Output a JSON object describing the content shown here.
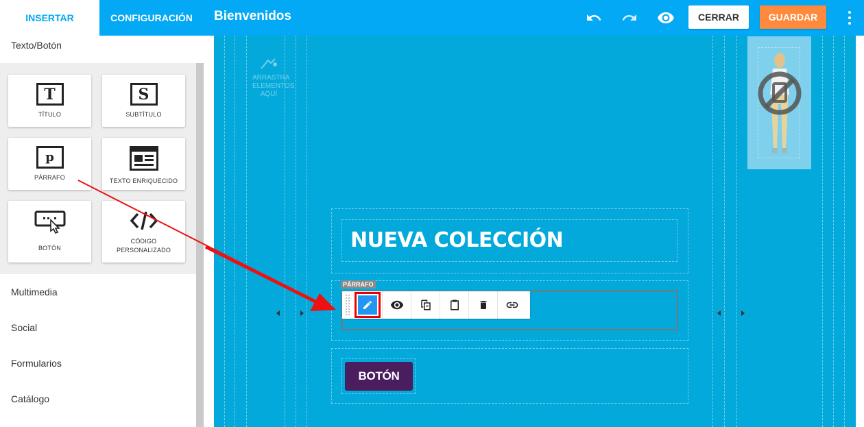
{
  "tabs": {
    "insert": "INSERTAR",
    "config": "CONFIGURACIÓN"
  },
  "header": {
    "title": "Bienvenidos",
    "close_label": "CERRAR",
    "save_label": "GUARDAR"
  },
  "sidebar": {
    "section_text": "Texto/Botón",
    "widgets": [
      {
        "label": "TÍTULO",
        "icon": "T"
      },
      {
        "label": "SUBTÍTULO",
        "icon": "S"
      },
      {
        "label": "PÁRRAFO",
        "icon": "p"
      },
      {
        "label": "TEXTO ENRIQUECIDO",
        "icon": "rich-text-icon"
      },
      {
        "label": "BOTÓN",
        "icon": "button-icon"
      },
      {
        "label": "CÓDIGO PERSONALIZADO",
        "icon": "code-icon"
      }
    ],
    "sections": [
      "Multimedia",
      "Social",
      "Formularios",
      "Catálogo"
    ]
  },
  "canvas": {
    "drop_hint": "ARRASTRA ELEMENTOS AQUÍ",
    "heading": "NUEVA COLECCIÓN",
    "paragraph_tag": "PÁRRAFO",
    "button_text": "BOTÓN"
  },
  "colors": {
    "header": "#03a9f4",
    "save": "#ff8a3d",
    "content_bg": "#03a9db",
    "button": "#4a1d5e",
    "highlight": "#ee0000"
  }
}
